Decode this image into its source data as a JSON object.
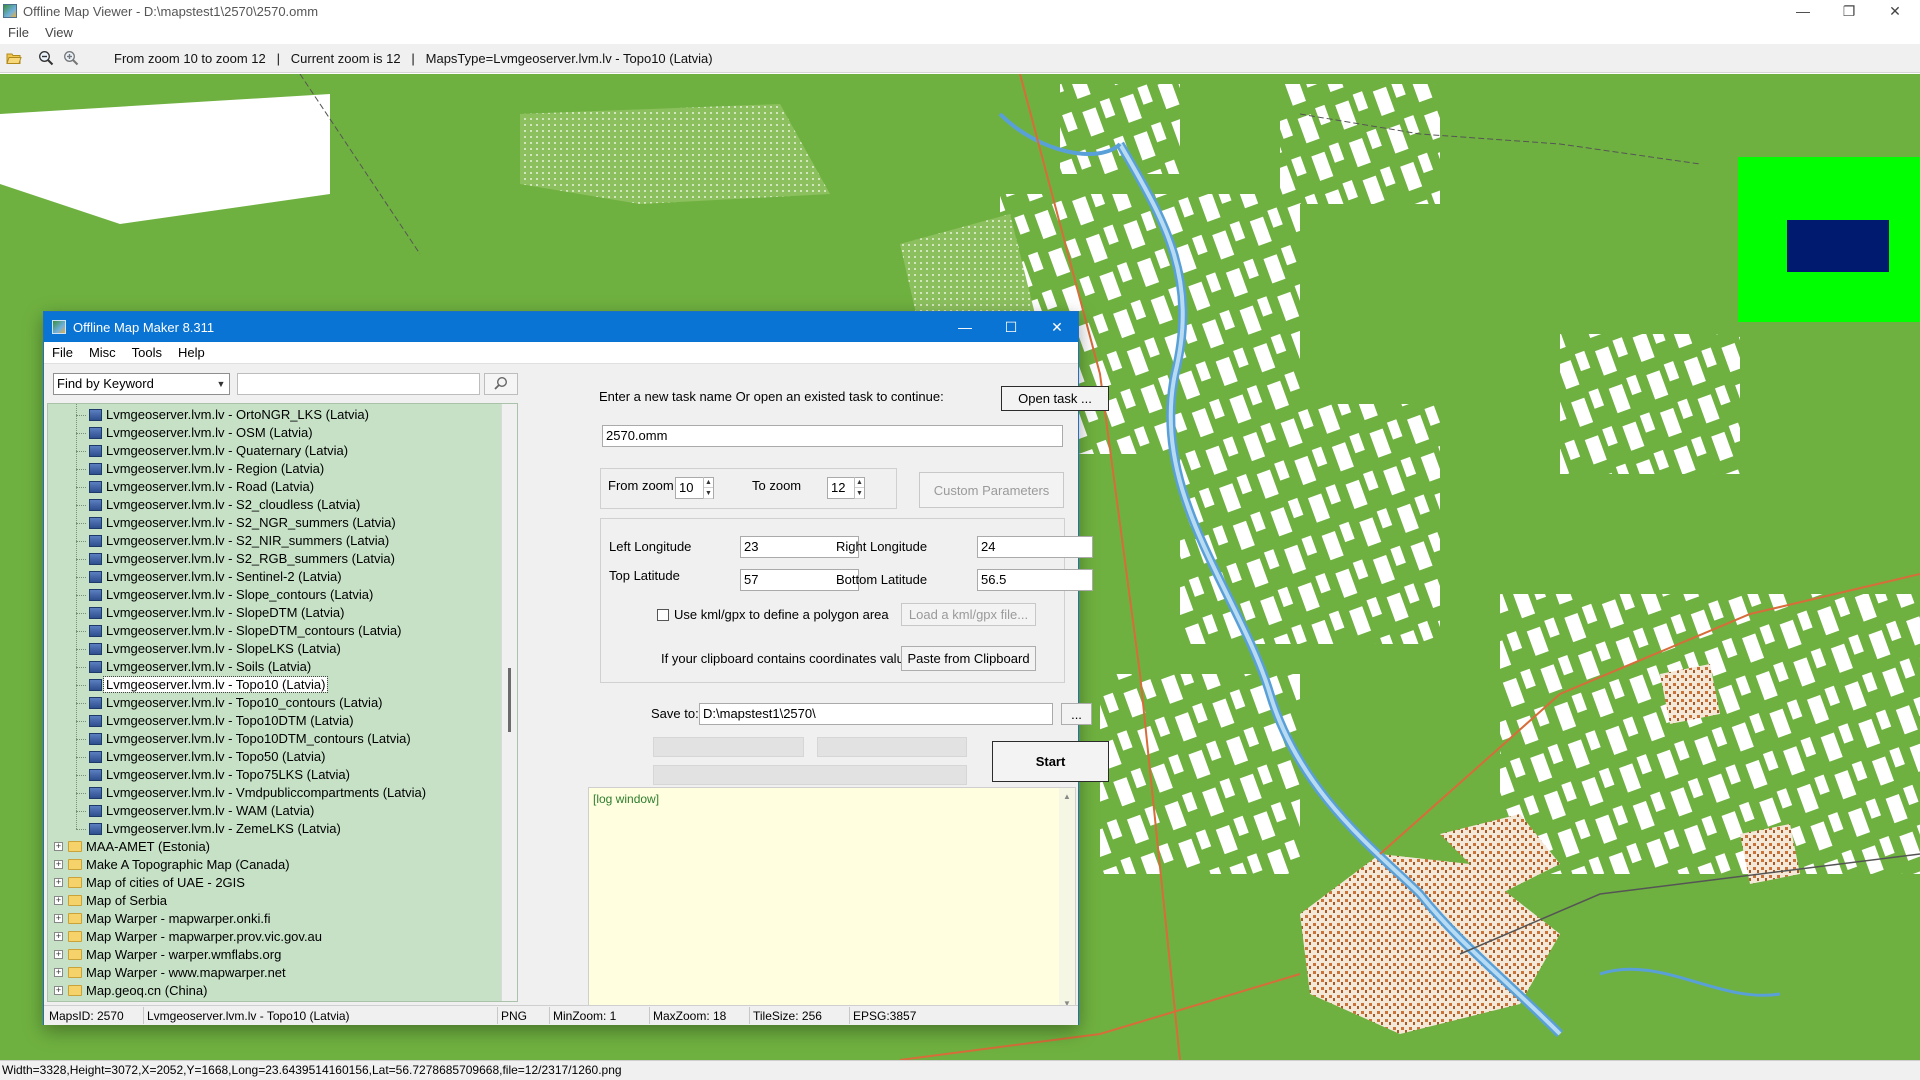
{
  "window": {
    "title": "Offline Map Viewer - D:\\mapstest1\\2570\\2570.omm",
    "controls": [
      "—",
      "❐",
      "✕"
    ]
  },
  "menu": [
    "File",
    "View"
  ],
  "toolbar": {
    "info": "From zoom 10 to zoom 12   |   Current zoom is 12   |   MapsType=Lvmgeoserver.lvm.lv - Topo10 (Latvia)"
  },
  "colors": {
    "map_green": "#6fb140",
    "minimap_bg": "#00ff00",
    "minimap_view": "#001a70",
    "dialog_title": "#0a74d4",
    "tree_bg": "#c6e1c6",
    "log_bg": "#ffffe0"
  },
  "statusbar": {
    "text": "Width=3328,Height=3072,X=2052,Y=1668,Long=23.6439514160156,Lat=56.7278685709668,file=12/2317/1260.png"
  },
  "dialog": {
    "title": "Offline Map Maker 8.311",
    "controls": [
      "—",
      "☐",
      "✕"
    ],
    "menu": [
      "File",
      "Misc",
      "Tools",
      "Help"
    ],
    "search": {
      "mode": "Find by Keyword",
      "keyword": "",
      "icon": "search-icon"
    },
    "tree": {
      "layers": [
        "Lvmgeoserver.lvm.lv - OrtoNGR_LKS (Latvia)",
        "Lvmgeoserver.lvm.lv - OSM (Latvia)",
        "Lvmgeoserver.lvm.lv - Quaternary (Latvia)",
        "Lvmgeoserver.lvm.lv - Region (Latvia)",
        "Lvmgeoserver.lvm.lv - Road (Latvia)",
        "Lvmgeoserver.lvm.lv - S2_cloudless (Latvia)",
        "Lvmgeoserver.lvm.lv - S2_NGR_summers (Latvia)",
        "Lvmgeoserver.lvm.lv - S2_NIR_summers (Latvia)",
        "Lvmgeoserver.lvm.lv - S2_RGB_summers (Latvia)",
        "Lvmgeoserver.lvm.lv - Sentinel-2 (Latvia)",
        "Lvmgeoserver.lvm.lv - Slope_contours (Latvia)",
        "Lvmgeoserver.lvm.lv - SlopeDTM (Latvia)",
        "Lvmgeoserver.lvm.lv - SlopeDTM_contours (Latvia)",
        "Lvmgeoserver.lvm.lv - SlopeLKS (Latvia)",
        "Lvmgeoserver.lvm.lv - Soils (Latvia)",
        "Lvmgeoserver.lvm.lv - Topo10 (Latvia)",
        "Lvmgeoserver.lvm.lv - Topo10_contours (Latvia)",
        "Lvmgeoserver.lvm.lv - Topo10DTM (Latvia)",
        "Lvmgeoserver.lvm.lv - Topo10DTM_contours (Latvia)",
        "Lvmgeoserver.lvm.lv - Topo50 (Latvia)",
        "Lvmgeoserver.lvm.lv - Topo75LKS (Latvia)",
        "Lvmgeoserver.lvm.lv - Vmdpubliccompartments (Latvia)",
        "Lvmgeoserver.lvm.lv - WAM (Latvia)",
        "Lvmgeoserver.lvm.lv - ZemeLKS (Latvia)"
      ],
      "selected_index": 15,
      "folders": [
        "MAA-AMET (Estonia)",
        "Make A Topographic Map (Canada)",
        "Map of cities of UAE - 2GIS",
        "Map of Serbia",
        "Map Warper - mapwarper.onki.fi",
        "Map Warper - mapwarper.prov.vic.gov.au",
        "Map Warper - warper.wmflabs.org",
        "Map Warper - www.mapwarper.net",
        "Map.geoq.cn (China)"
      ]
    },
    "task": {
      "prompt": "Enter a new task name Or open an existed task to continue:",
      "open_button": "Open task ...",
      "name": "2570.omm"
    },
    "zoom": {
      "from_label": "From zoom",
      "from_value": "10",
      "to_label": "To zoom",
      "to_value": "12",
      "custom_button": "Custom Parameters"
    },
    "area": {
      "left_lon_label": "Left Longitude",
      "left_lon": "23",
      "right_lon_label": "Right Longitude",
      "right_lon": "24",
      "top_lat_label": "Top Latitude",
      "top_lat": "57",
      "bottom_lat_label": "Bottom Latitude",
      "bottom_lat": "56.5",
      "kml_label": "Use kml/gpx to define a polygon area",
      "kml_checked": false,
      "kml_button": "Load a kml/gpx file...",
      "clipboard_label": "If your clipboard contains coordinates values:",
      "clipboard_button": "Paste from Clipboard"
    },
    "save": {
      "label": "Save to:",
      "path": "D:\\mapstest1\\2570\\",
      "browse": "..."
    },
    "start_button": "Start",
    "log": "[log window]",
    "status": {
      "maps_id": "MapsID: 2570",
      "maps_type": "Lvmgeoserver.lvm.lv - Topo10 (Latvia)",
      "format": "PNG",
      "min_zoom": "MinZoom: 1",
      "max_zoom": "MaxZoom: 18",
      "tile_size": "TileSize: 256",
      "epsg": "EPSG:3857"
    }
  }
}
